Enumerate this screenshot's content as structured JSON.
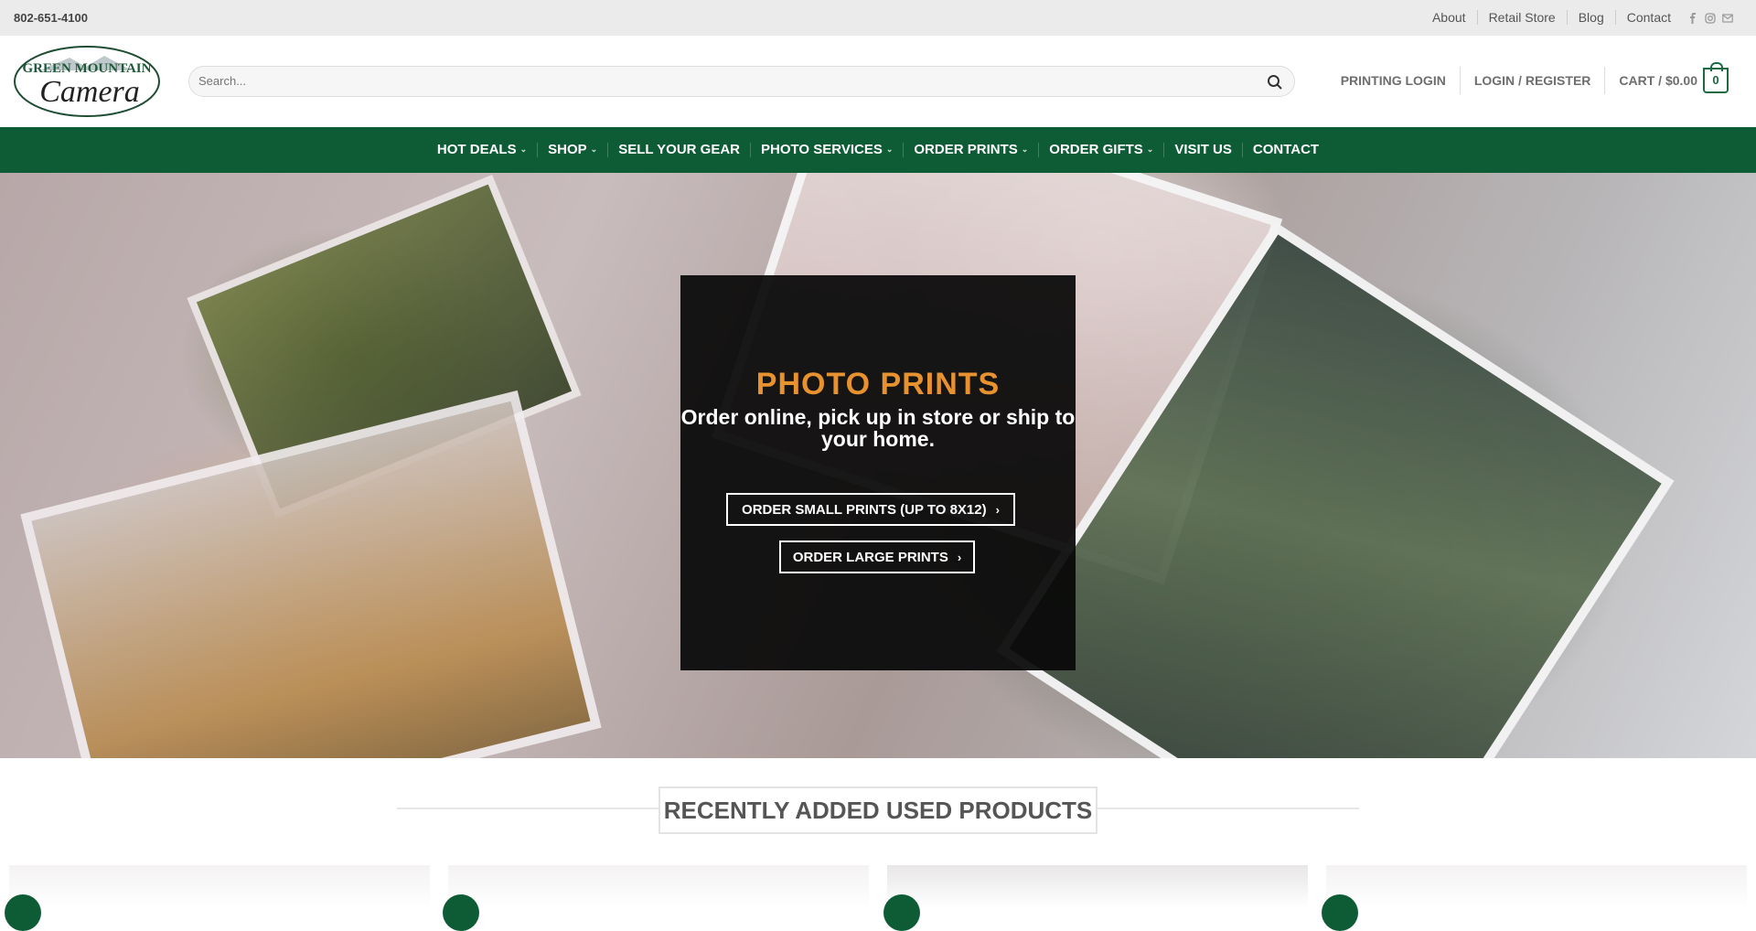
{
  "topbar": {
    "phone": "802-651-4100",
    "links": [
      "About",
      "Retail Store",
      "Blog",
      "Contact"
    ],
    "social_icons": [
      "facebook-icon",
      "instagram-icon",
      "envelope-icon"
    ]
  },
  "header": {
    "logo_text_1": "GREEN MOUNTAIN",
    "logo_text_2": "Camera",
    "search_placeholder": "Search...",
    "printing_login": "PRINTING LOGIN",
    "login_register": "LOGIN / REGISTER",
    "cart_label": "CART / $0.00",
    "cart_count": "0"
  },
  "mainnav": {
    "items": [
      {
        "label": "HOT DEALS",
        "dropdown": true
      },
      {
        "label": "SHOP",
        "dropdown": true
      },
      {
        "label": "SELL YOUR GEAR",
        "dropdown": false
      },
      {
        "label": "PHOTO SERVICES",
        "dropdown": true
      },
      {
        "label": "ORDER PRINTS",
        "dropdown": true
      },
      {
        "label": "ORDER GIFTS",
        "dropdown": true
      },
      {
        "label": "VISIT US",
        "dropdown": false
      },
      {
        "label": "CONTACT",
        "dropdown": false
      }
    ]
  },
  "hero": {
    "title": "PHOTO PRINTS",
    "subtitle": "Order online, pick up in store or ship to your home.",
    "button_small": "ORDER SMALL PRINTS (UP TO 8X12)",
    "button_large": "ORDER LARGE PRINTS"
  },
  "section": {
    "title": "RECENTLY ADDED USED PRODUCTS"
  },
  "colors": {
    "brand_green": "#0d5c35",
    "accent_orange": "#e8922f"
  }
}
